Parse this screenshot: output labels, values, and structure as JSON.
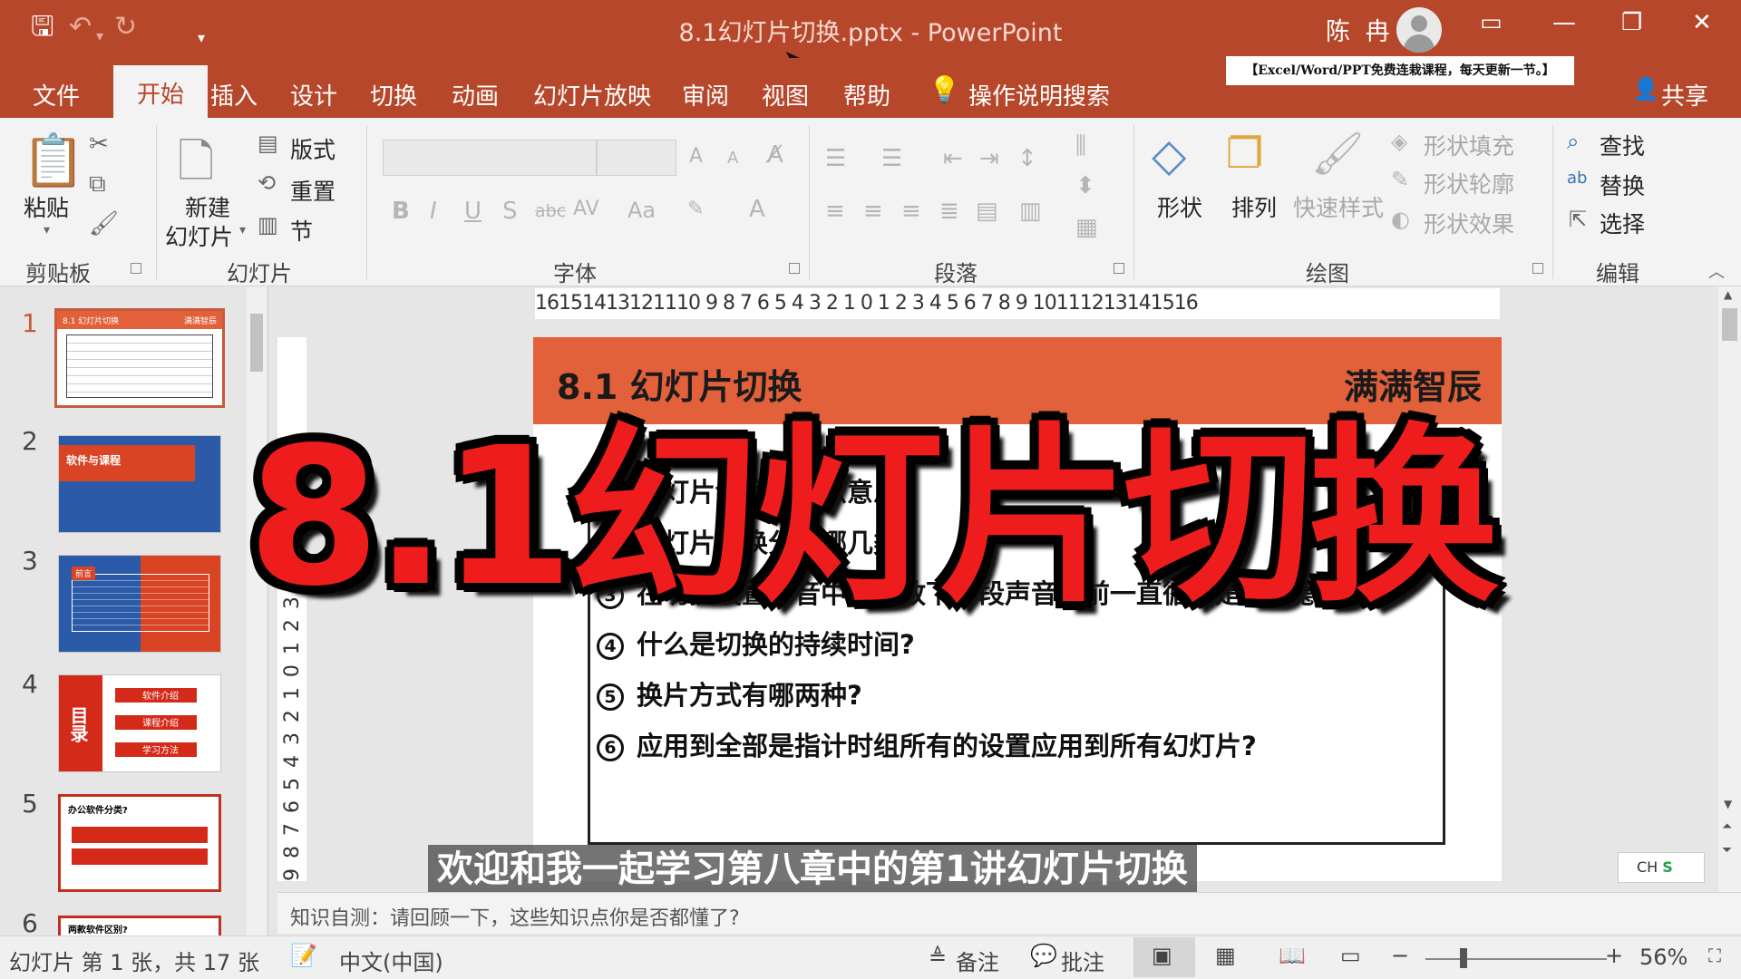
{
  "window": {
    "doc_title": "8.1幻灯片切换.pptx  -  PowerPoint",
    "user_name": "陈 冉",
    "banner": "【Excel/Word/PPT免费连栽课程，每天更新一节。】",
    "share": "共享"
  },
  "tabs": [
    "文件",
    "开始",
    "插入",
    "设计",
    "切换",
    "动画",
    "幻灯片放映",
    "审阅",
    "视图",
    "帮助",
    "操作说明搜索"
  ],
  "ribbon": {
    "clipboard": {
      "paste": "粘贴",
      "group": "剪贴板"
    },
    "slides": {
      "new_slide_l1": "新建",
      "new_slide_l2": "幻灯片",
      "layout": "版式",
      "reset": "重置",
      "section": "节",
      "group": "幻灯片"
    },
    "font": {
      "group": "字体",
      "aa_label": "Aa"
    },
    "paragraph": {
      "group": "段落"
    },
    "drawing": {
      "shapes": "形状",
      "arrange": "排列",
      "quick_styles": "快速样式",
      "shape_fill": "形状填充",
      "shape_outline": "形状轮廓",
      "shape_effects": "形状效果",
      "group": "绘图"
    },
    "editing": {
      "find": "查找",
      "replace": "替换",
      "select": "选择",
      "group": "编辑"
    }
  },
  "ruler": {
    "horizontal": "16151413121110 9 8 7 6 5 4 3 2 1 0 1 2 3 4 5 6 7 8 9 10111213141516",
    "vertical": "9 8 7 6 5 4 3 2 1 0 1 2 3 4 5 6 7 8 9"
  },
  "thumbnails": {
    "numbers": [
      "1",
      "2",
      "3",
      "4",
      "5",
      "6"
    ],
    "t1_title": "8.1 幻灯片切换",
    "t1_brand": "满满智辰",
    "t2_title": "软件与课程",
    "t3_tag": "前言",
    "t4_toc": "目录",
    "t4_items": [
      "软件介绍",
      "课程介绍",
      "学习方法"
    ],
    "t5_title": "办公软件分类?",
    "t6_title": "两款软件区别?"
  },
  "slide": {
    "title": "8.1 幻灯片切换",
    "brand": "满满智辰",
    "questions": [
      {
        "num": "1",
        "text": "幻灯片切换是什么意思？"
      },
      {
        "num": "2",
        "text": "幻灯片切换分为哪几类？"
      },
      {
        "num": "3",
        "text": "在切换设置声音中，播放下一段声音之前一直循环是什么意思？"
      },
      {
        "num": "4",
        "text": "什么是切换的持续时间?"
      },
      {
        "num": "5",
        "text": "换片方式有哪两种?"
      },
      {
        "num": "6",
        "text": "应用到全部是指计时组所有的设置应用到所有幻灯片?"
      }
    ]
  },
  "overlay": {
    "big_title": "8.1幻灯片切换",
    "subtitle": "欢迎和我一起学习第八章中的第1讲幻灯片切换"
  },
  "notes": "知识自测：请回顾一下，这些知识点你是否都懂了?",
  "status": {
    "slide_info": "幻灯片 第 1 张，共 17 张",
    "language": "中文(中国)",
    "notes_btn": "备注",
    "comments_btn": "批注",
    "zoom": "56%",
    "ime": "CH"
  },
  "colors": {
    "accent": "#b7472a",
    "slide_header": "#e2613a",
    "overlay_red": "#ee1c1c"
  }
}
